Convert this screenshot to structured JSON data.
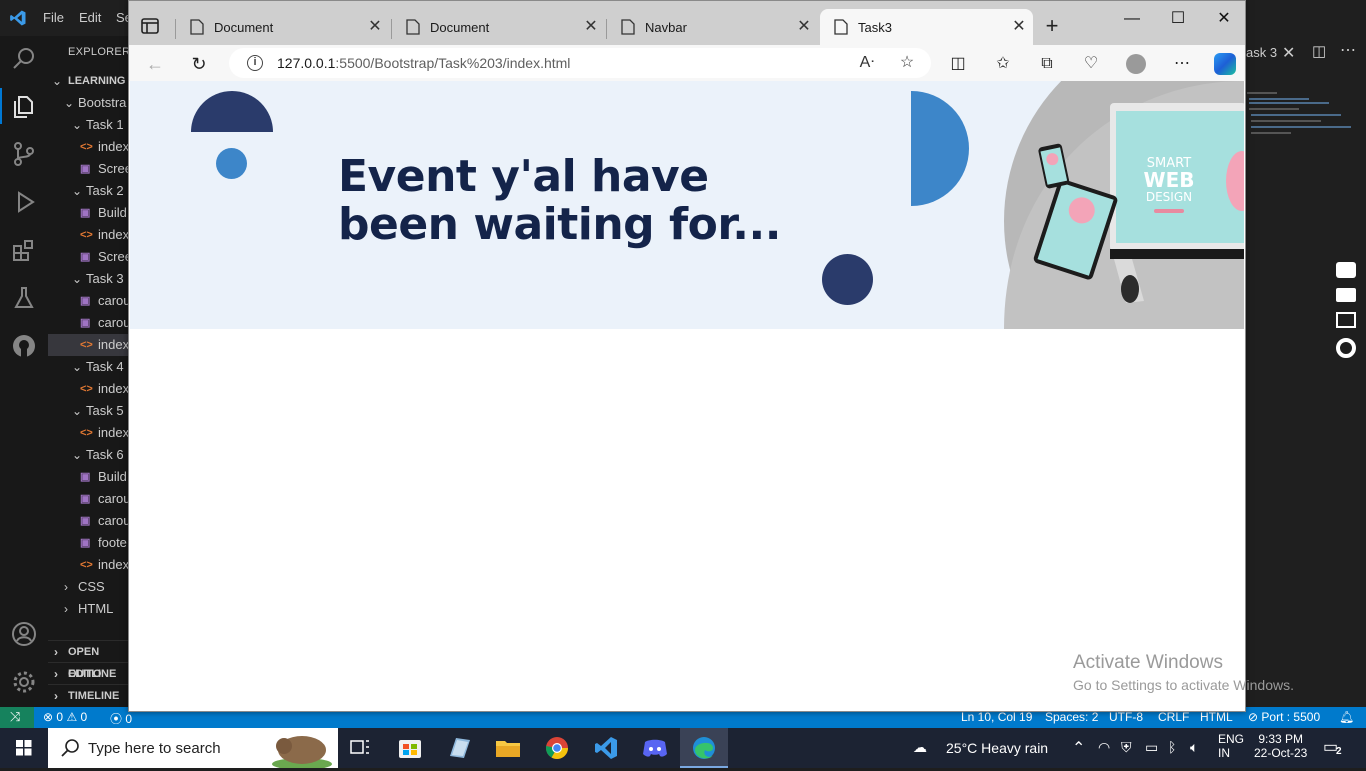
{
  "vscode": {
    "menu": [
      "File",
      "Edit",
      "Se"
    ],
    "explorer_title": "EXPLORER",
    "tree": [
      {
        "label": "LEARNING",
        "kind": "root"
      },
      {
        "label": "Bootstra",
        "kind": "folder"
      },
      {
        "label": "Task 1",
        "kind": "folder"
      },
      {
        "label": "index",
        "kind": "html"
      },
      {
        "label": "Scree",
        "kind": "image"
      },
      {
        "label": "Task 2",
        "kind": "folder"
      },
      {
        "label": "Build",
        "kind": "image"
      },
      {
        "label": "index",
        "kind": "html"
      },
      {
        "label": "Scree",
        "kind": "image"
      },
      {
        "label": "Task 3",
        "kind": "folder"
      },
      {
        "label": "carou",
        "kind": "image"
      },
      {
        "label": "carou",
        "kind": "image"
      },
      {
        "label": "index",
        "kind": "html"
      },
      {
        "label": "Task 4",
        "kind": "folder"
      },
      {
        "label": "index",
        "kind": "html"
      },
      {
        "label": "Task 5",
        "kind": "folder"
      },
      {
        "label": "index",
        "kind": "html"
      },
      {
        "label": "Task 6",
        "kind": "folder"
      },
      {
        "label": "Build",
        "kind": "image"
      },
      {
        "label": "carou",
        "kind": "image"
      },
      {
        "label": "carou",
        "kind": "image"
      },
      {
        "label": "foote",
        "kind": "image"
      },
      {
        "label": "index",
        "kind": "html"
      },
      {
        "label": "CSS",
        "kind": "collapsed"
      },
      {
        "label": "HTML",
        "kind": "collapsed"
      }
    ],
    "sections": [
      "OPEN EDITO",
      "OUTLINE",
      "TIMELINE"
    ],
    "right_tab_label": "ask 3",
    "status": {
      "errors": "0",
      "warnings": "0",
      "ports": "0",
      "cursor": "Ln 10, Col 19",
      "spaces": "Spaces: 2",
      "encoding": "UTF-8",
      "eol": "CRLF",
      "language": "HTML",
      "port": "Port : 5500"
    }
  },
  "browser": {
    "tabs": [
      {
        "title": "Document"
      },
      {
        "title": "Document"
      },
      {
        "title": "Navbar"
      },
      {
        "title": "Task3"
      }
    ],
    "url_host": "127.0.0.1",
    "url_rest": ":5500/Bootstrap/Task%203/index.html"
  },
  "page": {
    "heading_line1": "Event y'al have",
    "heading_line2": "been waiting for...",
    "colors": {
      "navy": "#2a3b6b",
      "blue": "#3d86c9",
      "hero_bg": "#ebf2fa",
      "heading": "#14244a"
    },
    "image_texts": [
      "SMART",
      "WEB",
      "DESIGN"
    ]
  },
  "watermark": {
    "title": "Activate Windows",
    "subtitle": "Go to Settings to activate Windows."
  },
  "taskbar": {
    "search_placeholder": "Type here to search",
    "weather": "25°C  Heavy rain",
    "lang_line1": "ENG",
    "lang_line2": "IN",
    "time": "9:33 PM",
    "date": "22-Oct-23",
    "notification_count": "2"
  }
}
